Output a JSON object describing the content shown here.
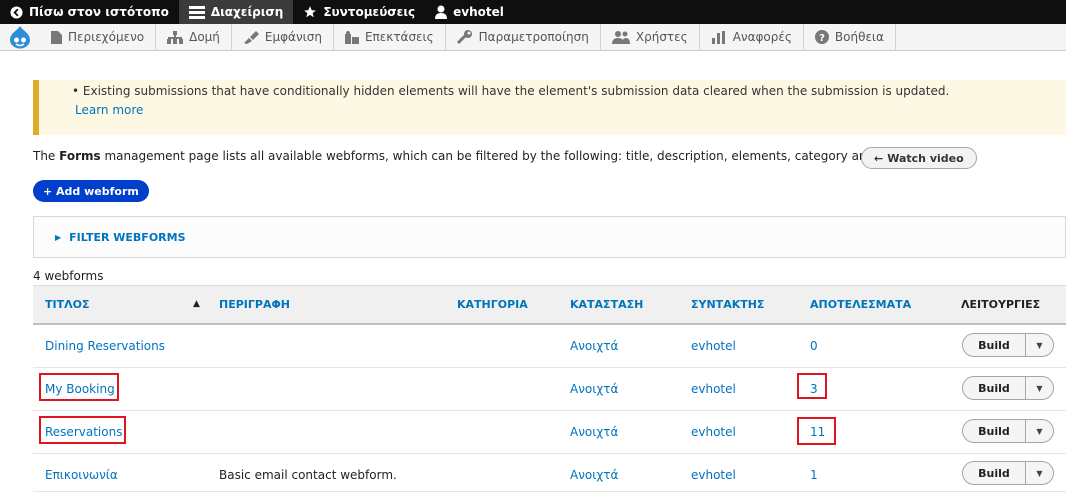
{
  "toolbar": {
    "back_label": "Πίσω στον ιστότοπο",
    "manage_label": "Διαχείριση",
    "shortcuts_label": "Συντομεύσεις",
    "user_label": "evhotel"
  },
  "tray": {
    "items": [
      "Περιεχόμενο",
      "Δομή",
      "Εμφάνιση",
      "Επεκτάσεις",
      "Παραμετροποίηση",
      "Χρήστες",
      "Αναφορές",
      "Βοήθεια"
    ]
  },
  "message": {
    "text": "Existing submissions that have conditionally hidden elements will have the element's submission data cleared when the submission is updated.",
    "learn_more": "Learn more"
  },
  "intro": {
    "pre": "The ",
    "bold": "Forms",
    "post": " management page lists all available webforms, which can be filtered by the following: title, description, elements, category and status.",
    "watch_video": "Watch video"
  },
  "add_webform": "+ Add webform",
  "filter_label": "FILTER WEBFORMS",
  "count": "4 webforms",
  "table": {
    "headers": {
      "title": "ΤΙΤΛΟΣ",
      "description": "ΠΕΡΙΓΡΑΦΗ",
      "category": "ΚΑΤΗΓΟΡΙΑ",
      "status": "ΚΑΤΑΣΤΑΣΗ",
      "author": "ΣΥΝΤΑΚΤΗΣ",
      "results": "ΑΠΟΤΕΛΕΣΜΑΤΑ",
      "operations": "ΛΕΙΤΟΥΡΓΙΕΣ"
    },
    "rows": [
      {
        "title": "Dining Reservations",
        "description": "",
        "status": "Ανοιχτά",
        "author": "evhotel",
        "results": "0",
        "op": "Build"
      },
      {
        "title": "My Booking",
        "description": "",
        "status": "Ανοιχτά",
        "author": "evhotel",
        "results": "3",
        "op": "Build"
      },
      {
        "title": "Reservations",
        "description": "",
        "status": "Ανοιχτά",
        "author": "evhotel",
        "results": "11",
        "op": "Build"
      },
      {
        "title": "Επικοινωνία",
        "description": "Basic email contact webform.",
        "status": "Ανοιχτά",
        "author": "evhotel",
        "results": "1",
        "op": "Build"
      }
    ]
  },
  "colors": {
    "link": "#0074bd",
    "highlight": "#e0141e",
    "warning_border": "#e0a926",
    "primary_button": "#003ecc"
  }
}
